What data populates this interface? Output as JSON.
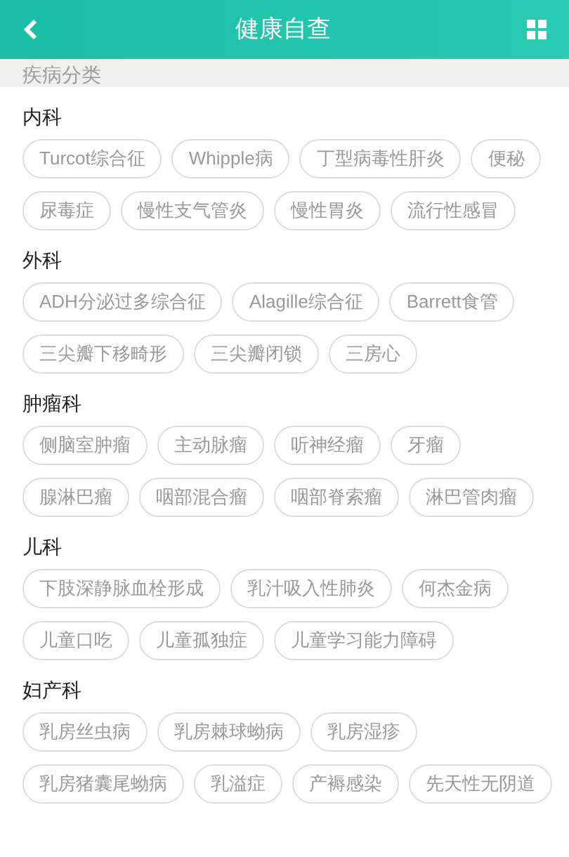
{
  "header": {
    "title": "健康自查"
  },
  "subheader": {
    "title": "疾病分类"
  },
  "sections": [
    {
      "title": "内科",
      "items": [
        "Turcot综合征",
        "Whipple病",
        "丁型病毒性肝炎",
        "便秘",
        "尿毒症",
        "慢性支气管炎",
        "慢性胃炎",
        "流行性感冒"
      ]
    },
    {
      "title": "外科",
      "items": [
        "ADH分泌过多综合征",
        "Alagille综合征",
        "Barrett食管",
        "三尖瓣下移畸形",
        "三尖瓣闭锁",
        "三房心"
      ]
    },
    {
      "title": "肿瘤科",
      "items": [
        "侧脑室肿瘤",
        "主动脉瘤",
        "听神经瘤",
        "牙瘤",
        "腺淋巴瘤",
        "咽部混合瘤",
        "咽部脊索瘤",
        "淋巴管肉瘤"
      ]
    },
    {
      "title": "儿科",
      "items": [
        "下肢深静脉血栓形成",
        "乳汁吸入性肺炎",
        "何杰金病",
        "儿童口吃",
        "儿童孤独症",
        "儿童学习能力障碍"
      ]
    },
    {
      "title": "妇产科",
      "items": [
        "乳房丝虫病",
        "乳房棘球蚴病",
        "乳房湿疹",
        "乳房猪囊尾蚴病",
        "乳溢症",
        "产褥感染",
        "先天性无阴道"
      ]
    }
  ]
}
